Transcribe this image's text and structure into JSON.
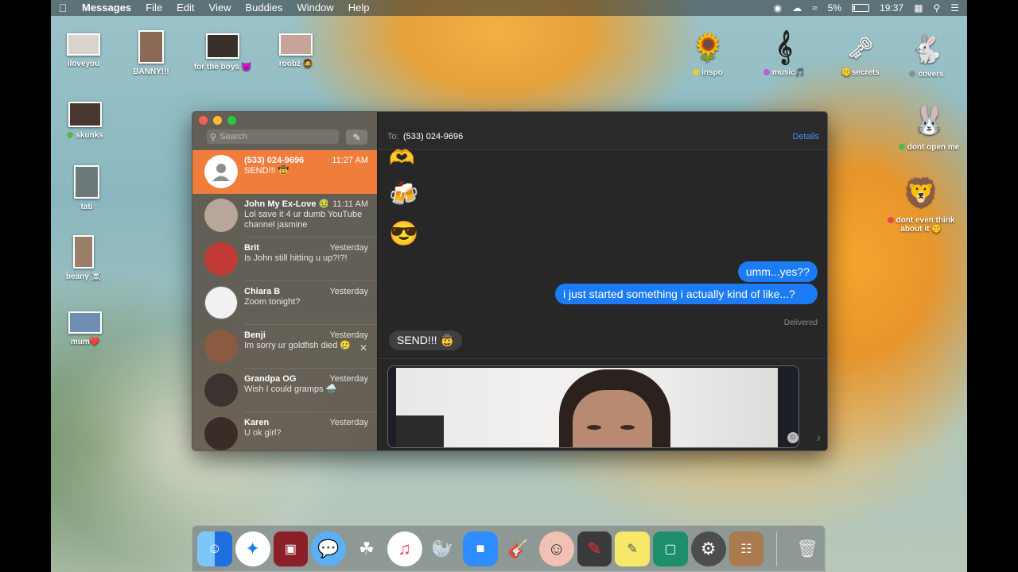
{
  "menubar": {
    "app_name": "Messages",
    "menus": [
      "File",
      "Edit",
      "View",
      "Buddies",
      "Window",
      "Help"
    ],
    "battery": "5%",
    "clock": "19:37"
  },
  "desktop_icons": {
    "left": [
      {
        "label": "iloveyou"
      },
      {
        "label": "BANNY!!!"
      },
      {
        "label": "for the boys 😈"
      },
      {
        "label": "roobz 🧔"
      },
      {
        "label": "skunks"
      },
      {
        "label": "tati"
      },
      {
        "label": "beany ☠️"
      },
      {
        "label": "mum❤️"
      }
    ],
    "right": [
      {
        "label": "inspo"
      },
      {
        "label": "music🎵"
      },
      {
        "label": "🤫secrets"
      },
      {
        "label": "covers"
      },
      {
        "label": "dont open me"
      },
      {
        "label": "dont even think about it 🤫"
      }
    ]
  },
  "sidebar": {
    "search_placeholder": "Search",
    "conversations": [
      {
        "name": "(533) 024-9696",
        "time": "11:27 AM",
        "preview": "SEND!!! 🤠",
        "active": true
      },
      {
        "name": "John My Ex-Love 🤢...",
        "time": "11:11 AM",
        "preview": "Lol save it 4 ur dumb YouTube channel jasmine"
      },
      {
        "name": "Brit",
        "time": "Yesterday",
        "preview": "Is John still hitting u up?!?!"
      },
      {
        "name": "Chiara B",
        "time": "Yesterday",
        "preview": "Zoom tonight?"
      },
      {
        "name": "Benji",
        "time": "Yesterday",
        "preview": "Im sorry ur goldfish died 🥲"
      },
      {
        "name": "Grandpa OG",
        "time": "Yesterday",
        "preview": "Wish I could gramps 🌧️"
      },
      {
        "name": "Karen",
        "time": "Yesterday",
        "preview": "U ok girl?"
      }
    ]
  },
  "chat": {
    "to_label": "To:",
    "to_value": "(533) 024-9696",
    "details_label": "Details",
    "emojis": [
      "🫶",
      "🍻",
      "😎"
    ],
    "outgoing": [
      "umm...yes??",
      "i just started something i actually kind of like...?"
    ],
    "delivered_label": "Delivered",
    "incoming": "SEND!!! 🤠"
  },
  "dock": {
    "apps": [
      "Finder",
      "Safari",
      "Photo Booth",
      "Messages",
      "Ninja",
      "Music",
      "Walrus",
      "Zoom",
      "GarageBand",
      "Face",
      "Photo Editor",
      "Stickies",
      "Preview",
      "System Preferences",
      "Contacts"
    ],
    "trash": "Trash"
  }
}
